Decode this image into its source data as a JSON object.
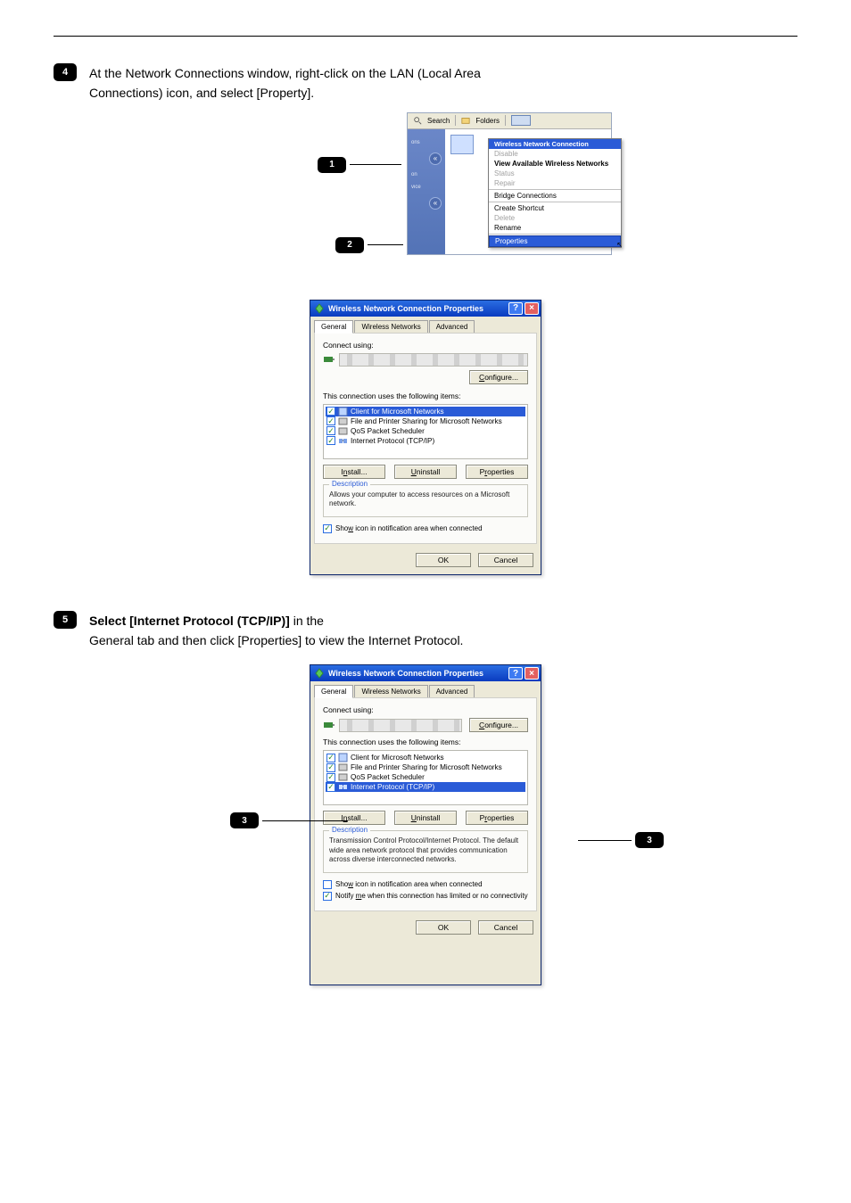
{
  "step4": {
    "text4": "At the Network Connections window, right-click on the LAN (Local Area Connections) icon, and select [Property].",
    "text5_title": "Select [Internet Protocol (TCP/IP)] ",
    "text5_body1": "in the",
    "text5_body2": "General tab and then click [Properties] to view the Internet Protocol.",
    "callouts": {
      "one": "1",
      "two": "2",
      "threeA": "3",
      "threeB": "3"
    }
  },
  "explorer": {
    "toolbar": {
      "search": "Search",
      "folders": "Folders"
    },
    "side": {
      "ons": "ons",
      "on": "on",
      "vice": "vice"
    },
    "menu": {
      "heading": "Wireless Network Connection",
      "disable": "Disable",
      "view": "View Available Wireless Networks",
      "status": "Status",
      "repair": "Repair",
      "bridge": "Bridge Connections",
      "shortcut": "Create Shortcut",
      "delete": "Delete",
      "rename": "Rename",
      "properties": "Properties"
    }
  },
  "dialog1": {
    "title": "Wireless Network Connection Properties",
    "tabs": {
      "general": "General",
      "wireless": "Wireless Networks",
      "advanced": "Advanced"
    },
    "connect_using": "Connect using:",
    "configure": "Configure...",
    "uses_items": "This connection uses the following items:",
    "items": {
      "client": "Client for Microsoft Networks",
      "fileshare": "File and Printer Sharing for Microsoft Networks",
      "qos": "QoS Packet Scheduler",
      "tcpip": "Internet Protocol (TCP/IP)"
    },
    "install": "Install...",
    "uninstall": "Uninstall",
    "properties": "Properties",
    "description_lbl": "Description",
    "description": "Allows your computer to access resources on a Microsoft network.",
    "show_icon": "Show icon in notification area when connected",
    "ok": "OK",
    "cancel": "Cancel"
  },
  "dialog2": {
    "title": "Wireless Network Connection Properties",
    "tabs": {
      "general": "General",
      "wireless": "Wireless Networks",
      "advanced": "Advanced"
    },
    "connect_using": "Connect using:",
    "configure": "Configure...",
    "uses_items": "This connection uses the following items:",
    "items": {
      "client": "Client for Microsoft Networks",
      "fileshare": "File and Printer Sharing for Microsoft Networks",
      "qos": "QoS Packet Scheduler",
      "tcpip": "Internet Protocol (TCP/IP)"
    },
    "install": "Install...",
    "uninstall": "Uninstall",
    "properties": "Properties",
    "description_lbl": "Description",
    "description": "Transmission Control Protocol/Internet Protocol. The default wide area network protocol that provides communication across diverse interconnected networks.",
    "show_icon": "Show icon in notification area when connected",
    "notify": "Notify me when this connection has limited or no connectivity",
    "ok": "OK",
    "cancel": "Cancel"
  }
}
